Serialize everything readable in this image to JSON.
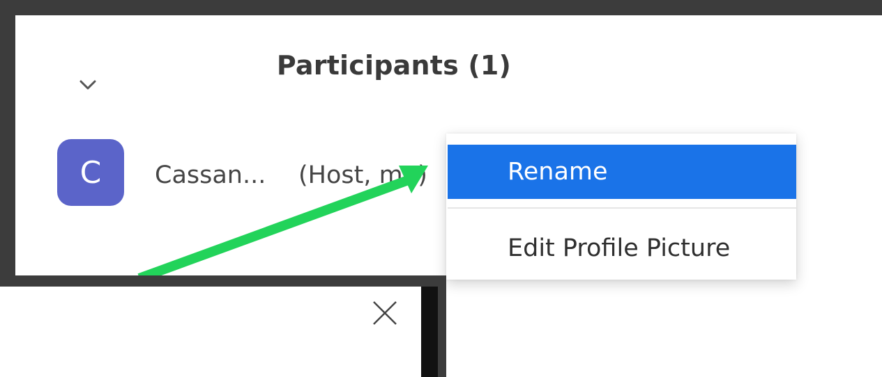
{
  "participants_panel": {
    "title": "Participants (1)",
    "collapse_icon": "chevron-down-icon"
  },
  "participant": {
    "avatar_initial": "C",
    "avatar_color": "#5b64c9",
    "name": "Cassan...",
    "role": "(Host, me)"
  },
  "context_menu": {
    "items": [
      {
        "label": "Rename",
        "highlighted": true
      },
      {
        "label": "Edit Profile Picture",
        "highlighted": false
      }
    ],
    "highlight_color": "#1a73e8"
  },
  "dialog": {
    "close_icon": "close-icon"
  },
  "annotation": {
    "arrow_color": "#22d35a"
  }
}
